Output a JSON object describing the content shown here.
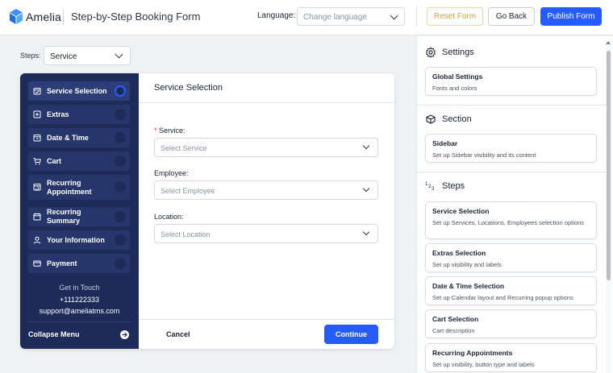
{
  "header": {
    "brand": "Amelia",
    "page_title": "Step-by-Step Booking Form",
    "language_label": "Language:",
    "language_placeholder": "Change language",
    "reset_label": "Reset Form",
    "back_label": "Go Back",
    "publish_label": "Publish Form"
  },
  "steps_bar": {
    "label": "Steps:",
    "selected": "Service"
  },
  "sidebar": {
    "items": [
      {
        "label": "Service Selection",
        "icon": "calendar-check-icon",
        "active": true
      },
      {
        "label": "Extras",
        "icon": "plus-square-icon"
      },
      {
        "label": "Date & Time",
        "icon": "calendar-clock-icon"
      },
      {
        "label": "Cart",
        "icon": "cart-icon"
      },
      {
        "label": "Recurring Appointment",
        "icon": "calendar-repeat-icon"
      },
      {
        "label": "Recurring Summary",
        "icon": "calendar-summary-icon"
      },
      {
        "label": "Your Information",
        "icon": "user-icon"
      },
      {
        "label": "Payment",
        "icon": "credit-card-icon"
      }
    ],
    "contact": {
      "title": "Get in Touch",
      "phone": "+111222333",
      "email": "support@ameliatms.com"
    },
    "collapse_label": "Collapse Menu"
  },
  "main": {
    "title": "Service Selection",
    "fields": [
      {
        "label": "Service:",
        "required": true,
        "placeholder": "Select Service"
      },
      {
        "label": "Employee:",
        "required": false,
        "placeholder": "Select Employee"
      },
      {
        "label": "Location:",
        "required": false,
        "placeholder": "Select Location"
      }
    ],
    "cancel_label": "Cancel",
    "continue_label": "Continue"
  },
  "right_panel": {
    "sections": [
      {
        "title": "Settings",
        "icon": "gear-icon",
        "cards": [
          {
            "title": "Global Settings",
            "desc": "Fonts and colors"
          }
        ]
      },
      {
        "title": "Section",
        "icon": "cube-icon",
        "cards": [
          {
            "title": "Sidebar",
            "desc": "Set up Sidebar visibility and its content"
          }
        ]
      },
      {
        "title": "Steps",
        "icon": "steps-numbers-icon",
        "cards": [
          {
            "title": "Service Selection",
            "desc": "Set up Services, Locations, Employees selection options"
          },
          {
            "title": "Extras Selection",
            "desc": "Set up visibility and labels"
          },
          {
            "title": "Date & Time Selection",
            "desc": "Set up Calendar layout and Recurring popup options"
          },
          {
            "title": "Cart Selection",
            "desc": "Cart description"
          },
          {
            "title": "Recurring Appointments",
            "desc": "Set up visibility, button type and labels"
          }
        ]
      }
    ]
  },
  "colors": {
    "primary": "#265cff",
    "sidebar": "#1d2b58",
    "reset": "#d8a03a",
    "required": "#e0343c"
  }
}
